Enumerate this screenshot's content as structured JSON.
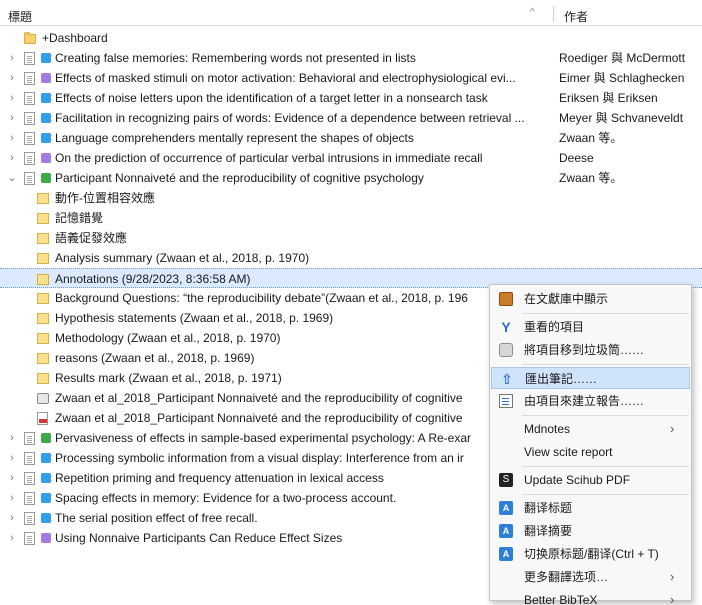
{
  "header": {
    "title_col": "標題",
    "author_col": "作者",
    "sort_indicator": "^"
  },
  "rows": [
    {
      "level": 0,
      "twisty": "",
      "icon": "folder",
      "title": "+Dashboard",
      "author": ""
    },
    {
      "level": 0,
      "twisty": "›",
      "icon": "doc",
      "tag_color": "#2f9fe6",
      "title": "Creating false memories: Remembering words not presented in lists",
      "author": "Roediger 與 McDermott"
    },
    {
      "level": 0,
      "twisty": "›",
      "icon": "doc",
      "tag_color": "#a27ae0",
      "title": "Effects of masked stimuli on motor activation: Behavioral and electrophysiological evi...",
      "author": "Eimer 與 Schlaghecken"
    },
    {
      "level": 0,
      "twisty": "›",
      "icon": "doc",
      "tag_color": "#2f9fe6",
      "title": "Effects of noise letters upon the identification of a target letter in a nonsearch task",
      "author": "Eriksen 與 Eriksen"
    },
    {
      "level": 0,
      "twisty": "›",
      "icon": "doc",
      "tag_color": "#2f9fe6",
      "title": "Facilitation in recognizing pairs of words: Evidence of a dependence between retrieval ...",
      "author": "Meyer 與 Schvaneveldt"
    },
    {
      "level": 0,
      "twisty": "›",
      "icon": "doc",
      "tag_color": "#2f9fe6",
      "title": "Language comprehenders mentally represent the shapes of objects",
      "author": "Zwaan 等。"
    },
    {
      "level": 0,
      "twisty": "›",
      "icon": "doc",
      "tag_color": "#a27ae0",
      "title": "On the prediction of occurrence of particular verbal intrusions in immediate recall",
      "author": "Deese"
    },
    {
      "level": 0,
      "twisty": "⌄",
      "icon": "doc",
      "tag_color": "#3ca94a",
      "title": "Participant Nonnaiveté and the reproducibility of cognitive psychology",
      "author": "Zwaan 等。"
    },
    {
      "level": 1,
      "icon": "note",
      "title": "動作-位置相容效應",
      "author": ""
    },
    {
      "level": 1,
      "icon": "note",
      "title": "記憶錯覺",
      "author": ""
    },
    {
      "level": 1,
      "icon": "note",
      "title": "語義促發效應",
      "author": ""
    },
    {
      "level": 1,
      "icon": "note",
      "title": "Analysis summary (Zwaan et al., 2018, p. 1970)",
      "author": ""
    },
    {
      "level": 1,
      "icon": "note",
      "title": "Annotations (9/28/2023, 8:36:58 AM)",
      "author": "",
      "selected": true
    },
    {
      "level": 1,
      "icon": "note",
      "title": "Background Questions: “the reproducibility debate”(Zwaan et al., 2018, p. 196",
      "author": ""
    },
    {
      "level": 1,
      "icon": "note",
      "title": "Hypothesis statements  (Zwaan et al., 2018, p. 1969)",
      "author": ""
    },
    {
      "level": 1,
      "icon": "note",
      "title": "Methodology (Zwaan et al., 2018, p. 1970)",
      "author": ""
    },
    {
      "level": 1,
      "icon": "note",
      "title": "reasons  (Zwaan et al., 2018, p. 1969)",
      "author": ""
    },
    {
      "level": 1,
      "icon": "note",
      "title": "Results mark (Zwaan et al., 2018, p. 1971)",
      "author": ""
    },
    {
      "level": 1,
      "icon": "attach",
      "title": "Zwaan et al_2018_Participant Nonnaiveté and the reproducibility of cognitive",
      "author": ""
    },
    {
      "level": 1,
      "icon": "pdf",
      "title": "Zwaan et al_2018_Participant Nonnaiveté and the reproducibility of cognitive",
      "author": ""
    },
    {
      "level": 0,
      "twisty": "›",
      "icon": "doc",
      "tag_color": "#3ca94a",
      "title": "Pervasiveness of effects in sample-based experimental psychology: A Re-exar",
      "author": ""
    },
    {
      "level": 0,
      "twisty": "›",
      "icon": "doc",
      "tag_color": "#2f9fe6",
      "title": "Processing symbolic information from a visual display: Interference from an ir",
      "author": ""
    },
    {
      "level": 0,
      "twisty": "›",
      "icon": "doc",
      "tag_color": "#2f9fe6",
      "title": "Repetition priming and frequency attenuation in lexical access",
      "author": ""
    },
    {
      "level": 0,
      "twisty": "›",
      "icon": "doc",
      "tag_color": "#2f9fe6",
      "title": "Spacing effects in memory: Evidence for a two-process account.",
      "author": ""
    },
    {
      "level": 0,
      "twisty": "›",
      "icon": "doc",
      "tag_color": "#2f9fe6",
      "title": "The serial position effect of free recall.",
      "author": ""
    },
    {
      "level": 0,
      "twisty": "›",
      "icon": "doc",
      "tag_color": "#a27ae0",
      "title": "Using Nonnaive Participants Can Reduce Effect Sizes",
      "author": ""
    }
  ],
  "context_menu": {
    "items": [
      {
        "label": "在文獻庫中顯示",
        "icon": "box",
        "icon_name": "library-box-icon"
      },
      {
        "sep": true
      },
      {
        "label": "重看的項目",
        "icon": "zpull",
        "icon_name": "duplicate-items-icon",
        "glyph": "Y"
      },
      {
        "label": "將項目移到垃圾筒……",
        "icon": "trash",
        "icon_name": "trash-icon"
      },
      {
        "sep": true
      },
      {
        "label": "匯出筆記……",
        "icon": "upd",
        "icon_name": "export-arrow-icon",
        "glyph": "⇧",
        "highlighted": true
      },
      {
        "label": "由項目來建立報告……",
        "icon": "rep",
        "icon_name": "report-icon"
      },
      {
        "sep": true
      },
      {
        "label": "Mdnotes",
        "arrow": "›"
      },
      {
        "label": "View scite report"
      },
      {
        "sep": true
      },
      {
        "label": "Update Scihub PDF",
        "icon": "scihub",
        "icon_name": "scihub-icon",
        "glyph": "S"
      },
      {
        "sep": true
      },
      {
        "label": "翻译标题",
        "icon": "tr",
        "icon_name": "translate-icon",
        "glyph": "A"
      },
      {
        "label": "翻译摘要",
        "icon": "tr",
        "icon_name": "translate-icon",
        "glyph": "A"
      },
      {
        "label": "切换原标题/翻译(Ctrl + T)",
        "icon": "tr",
        "icon_name": "translate-icon",
        "glyph": "A"
      },
      {
        "label": "更多翻譯选项…",
        "arrow": "›"
      },
      {
        "label": "Better BibTeX",
        "arrow": "›"
      }
    ]
  }
}
